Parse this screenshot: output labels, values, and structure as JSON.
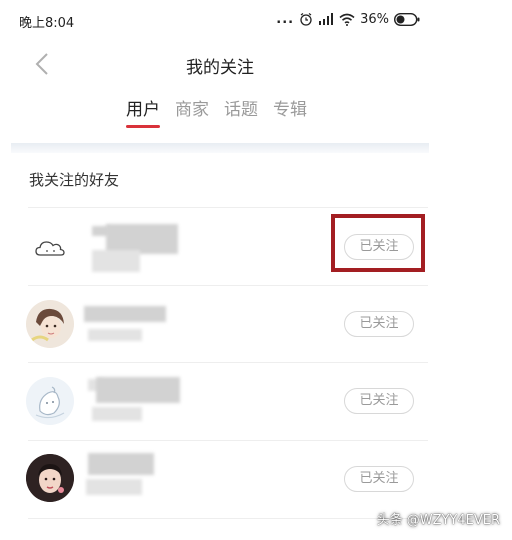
{
  "status_bar": {
    "time": "晚上8:04",
    "dots": "...",
    "battery": "36%",
    "icons": [
      "alarm-icon",
      "signal-icon",
      "wifi-icon",
      "battery-icon"
    ]
  },
  "header": {
    "title": "我的关注",
    "back_icon": "chevron-left-icon"
  },
  "tabs": [
    {
      "label": "用户",
      "active": true
    },
    {
      "label": "商家",
      "active": false
    },
    {
      "label": "话题",
      "active": false
    },
    {
      "label": "专辑",
      "active": false
    }
  ],
  "section": {
    "title": "我关注的好友"
  },
  "friends": [
    {
      "avatar": "cloud-avatar-icon",
      "follow_label": "已关注",
      "highlighted": true
    },
    {
      "avatar": "cartoon-avatar",
      "follow_label": "已关注",
      "highlighted": false
    },
    {
      "avatar": "sketch-avatar",
      "follow_label": "已关注",
      "highlighted": false
    },
    {
      "avatar": "photo-avatar",
      "follow_label": "已关注",
      "highlighted": false
    }
  ],
  "colors": {
    "accent": "#d9323a",
    "highlight_box": "#a31e22",
    "follow_border": "#d8d8d8",
    "inactive_tab": "#9a9a9a"
  },
  "watermark": "头条 @WZYY4EVER"
}
